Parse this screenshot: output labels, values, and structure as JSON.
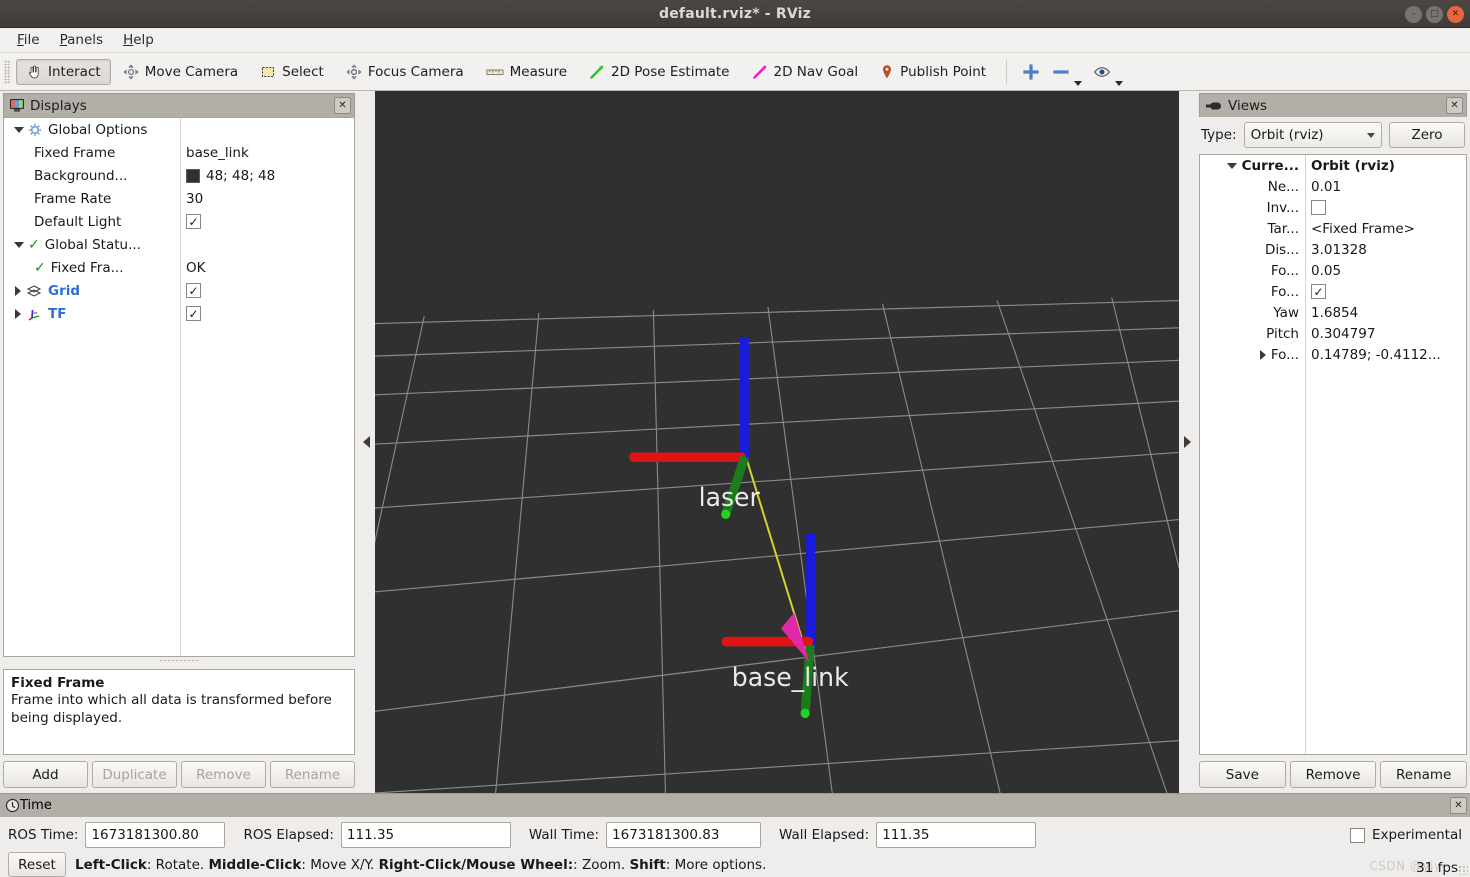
{
  "window": {
    "title": "default.rviz* - RViz",
    "controls": {
      "minimize": "–",
      "maximize": "□",
      "close": "✕"
    }
  },
  "menubar": {
    "items": [
      "File",
      "Panels",
      "Help"
    ]
  },
  "toolbar": {
    "buttons": [
      {
        "label": "Interact",
        "icon": "hand-pointer-icon",
        "active": true
      },
      {
        "label": "Move Camera",
        "icon": "move-camera-icon",
        "active": false
      },
      {
        "label": "Select",
        "icon": "select-rect-icon",
        "active": false
      },
      {
        "label": "Focus Camera",
        "icon": "focus-camera-icon",
        "active": false
      },
      {
        "label": "Measure",
        "icon": "ruler-icon",
        "active": false
      },
      {
        "label": "2D Pose Estimate",
        "icon": "green-arrow-icon",
        "active": false
      },
      {
        "label": "2D Nav Goal",
        "icon": "magenta-arrow-icon",
        "active": false
      },
      {
        "label": "Publish Point",
        "icon": "map-pin-icon",
        "active": false
      }
    ],
    "extra_icons": [
      "plus-icon",
      "minus-icon",
      "eye-icon"
    ]
  },
  "displays": {
    "panel_title": "Displays",
    "panel_icon": "monitor-icon",
    "close_label": "✕",
    "rows": [
      {
        "expander": "down",
        "icon": "gear-icon",
        "key": "Global Options",
        "value": "",
        "value_type": "none",
        "bold": false,
        "blue": false,
        "indent": 0
      },
      {
        "expander": "none",
        "icon": "none",
        "key": "Fixed Frame",
        "value": "base_link",
        "value_type": "text",
        "indent": 1
      },
      {
        "expander": "none",
        "icon": "none",
        "key": "Background...",
        "value": "48; 48; 48",
        "value_type": "color",
        "color": "#303030",
        "indent": 1
      },
      {
        "expander": "none",
        "icon": "none",
        "key": "Frame Rate",
        "value": "30",
        "value_type": "text",
        "indent": 1
      },
      {
        "expander": "none",
        "icon": "none",
        "key": "Default Light",
        "value": "✓",
        "value_type": "checkbox",
        "checked": true,
        "indent": 1
      },
      {
        "expander": "down",
        "icon": "green-check-icon",
        "key": "Global Statu...",
        "value": "",
        "value_type": "none",
        "indent": 0
      },
      {
        "expander": "none",
        "icon": "green-check-icon",
        "key": "Fixed Fra...",
        "value": "OK",
        "value_type": "text",
        "indent": 1
      },
      {
        "expander": "right",
        "icon": "grid-icon",
        "key": "Grid",
        "value": "✓",
        "value_type": "checkbox",
        "checked": true,
        "blue": true,
        "indent": 0
      },
      {
        "expander": "right",
        "icon": "axes-icon",
        "key": "TF",
        "value": "✓",
        "value_type": "checkbox",
        "checked": true,
        "blue": true,
        "indent": 0
      }
    ],
    "description": {
      "title": "Fixed Frame",
      "text": "Frame into which all data is transformed before being displayed."
    },
    "buttons": [
      {
        "label": "Add",
        "enabled": true
      },
      {
        "label": "Duplicate",
        "enabled": false
      },
      {
        "label": "Remove",
        "enabled": false
      },
      {
        "label": "Rename",
        "enabled": false
      }
    ]
  },
  "views": {
    "panel_title": "Views",
    "panel_icon": "camera-icon",
    "close_label": "✕",
    "type_label": "Type:",
    "type_value": "Orbit (rviz)",
    "zero_label": "Zero",
    "rows": [
      {
        "expander": "down",
        "key": "Curre...",
        "value": "Orbit (rviz)",
        "value_type": "text",
        "bold": true,
        "indent": 0
      },
      {
        "expander": "none",
        "key": "Ne...",
        "value": "0.01",
        "value_type": "text",
        "indent": 1
      },
      {
        "expander": "none",
        "key": "Inv...",
        "value": "",
        "value_type": "checkbox",
        "checked": false,
        "indent": 1
      },
      {
        "expander": "none",
        "key": "Tar...",
        "value": "<Fixed Frame>",
        "value_type": "text",
        "indent": 1
      },
      {
        "expander": "none",
        "key": "Dis...",
        "value": "3.01328",
        "value_type": "text",
        "indent": 1
      },
      {
        "expander": "none",
        "key": "Fo...",
        "value": "0.05",
        "value_type": "text",
        "indent": 1
      },
      {
        "expander": "none",
        "key": "Fo...",
        "value": "✓",
        "value_type": "checkbox",
        "checked": true,
        "indent": 1
      },
      {
        "expander": "none",
        "key": "Yaw",
        "value": "1.6854",
        "value_type": "text",
        "indent": 1
      },
      {
        "expander": "none",
        "key": "Pitch",
        "value": "0.304797",
        "value_type": "text",
        "indent": 1
      },
      {
        "expander": "right",
        "key": "Fo...",
        "value": "0.14789; -0.4112...",
        "value_type": "text",
        "indent": 1
      }
    ],
    "buttons": [
      {
        "label": "Save"
      },
      {
        "label": "Remove"
      },
      {
        "label": "Rename"
      }
    ]
  },
  "viewport": {
    "background_color": "#303030",
    "grid_color": "#969696",
    "frames": [
      {
        "name": "laser",
        "label_color": "#e8e8e8"
      },
      {
        "name": "base_link",
        "label_color": "#e8e8e8"
      }
    ],
    "axis_colors": {
      "x": "#e00000",
      "y": "#009000",
      "z": "#1414e0"
    },
    "connector_color": "#d2d22e",
    "arrow_color": "#e028a8",
    "collapse_left_icon": "triangle-left-icon",
    "collapse_right_icon": "triangle-right-icon"
  },
  "time": {
    "panel_title": "Time",
    "panel_icon": "clock-icon",
    "close_label": "✕",
    "fields": [
      {
        "label": "ROS Time:",
        "value": "1673181300.80"
      },
      {
        "label": "ROS Elapsed:",
        "value": "111.35"
      },
      {
        "label": "Wall Time:",
        "value": "1673181300.83"
      },
      {
        "label": "Wall Elapsed:",
        "value": "111.35"
      }
    ],
    "experimental_label": "Experimental",
    "experimental_checked": false,
    "reset_label": "Reset",
    "hint_parts": [
      {
        "t": "Left-Click",
        "b": true
      },
      {
        "t": ": Rotate. ",
        "b": false
      },
      {
        "t": "Middle-Click",
        "b": true
      },
      {
        "t": ": Move X/Y. ",
        "b": false
      },
      {
        "t": "Right-Click/Mouse Wheel:",
        "b": true
      },
      {
        "t": ": Zoom. ",
        "b": false
      },
      {
        "t": "Shift",
        "b": true
      },
      {
        "t": ": More options.",
        "b": false
      }
    ],
    "fps": "31 fps",
    "watermark": "CSDN @yjy—"
  }
}
